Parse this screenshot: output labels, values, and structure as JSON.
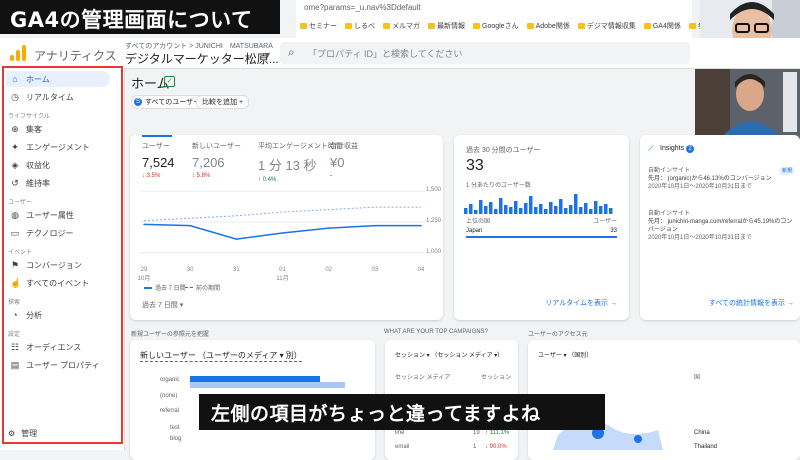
{
  "caption": {
    "title": "GA4の管理画面について",
    "subtitle": "左側の項目がちょっと違ってますよね"
  },
  "browser": {
    "url": "ome?params=_u.nav%3Ddefault",
    "bookmarks": [
      "セミナー",
      "しるべ",
      "メルマガ",
      "最新情報",
      "Googleさん",
      "Adobe関係",
      "デジマ情報収集",
      "GA4関係",
      "参考LPデザイン"
    ]
  },
  "header": {
    "app_name": "アナリティクス",
    "account_path": "すべてのアカウント > JUNICHI　MATSUBARA",
    "property_name": "デジタルマーケッター松原...",
    "search_placeholder": "「プロパティ ID」と検索してください",
    "colors": {
      "logo": "#f9ab00",
      "accent": "#1a73e8"
    }
  },
  "sidebar": {
    "items": [
      {
        "label": "ホーム",
        "icon": "home-icon",
        "glyph": "⌂",
        "active": true
      },
      {
        "label": "リアルタイム",
        "icon": "clock-icon",
        "glyph": "◷"
      }
    ],
    "sections": [
      {
        "title": "ライフサイクル",
        "items": [
          {
            "label": "集客",
            "icon": "acquisition-icon",
            "glyph": "⊕"
          },
          {
            "label": "エンゲージメント",
            "icon": "engagement-icon",
            "glyph": "✦"
          },
          {
            "label": "収益化",
            "icon": "monetization-icon",
            "glyph": "◈"
          },
          {
            "label": "維持率",
            "icon": "retention-icon",
            "glyph": "↺"
          }
        ]
      },
      {
        "title": "ユーザー",
        "items": [
          {
            "label": "ユーザー属性",
            "icon": "globe-icon",
            "glyph": "◍"
          },
          {
            "label": "テクノロジー",
            "icon": "devices-icon",
            "glyph": "▭"
          }
        ]
      },
      {
        "title": "イベント",
        "items": [
          {
            "label": "コンバージョン",
            "icon": "flag-icon",
            "glyph": "⚑"
          },
          {
            "label": "すべてのイベント",
            "icon": "touch-icon",
            "glyph": "☝"
          }
        ]
      },
      {
        "title": "探索",
        "items": [
          {
            "label": "分析",
            "icon": "analysis-icon",
            "glyph": "◔"
          }
        ]
      },
      {
        "title": "設定",
        "items": [
          {
            "label": "オーディエンス",
            "icon": "audience-icon",
            "glyph": "☷"
          },
          {
            "label": "ユーザー プロパティ",
            "icon": "property-icon",
            "glyph": "▤"
          }
        ]
      }
    ],
    "admin_label": "管理"
  },
  "main": {
    "title": "ホーム",
    "chip_all_users": "すべてのユーザー",
    "chip_all_users_avatar": "S",
    "chip_add_compare": "比較を追加",
    "metrics": [
      {
        "label": "ユーザー",
        "value": "7,524",
        "change": "↓ 3.5%",
        "dir": "down"
      },
      {
        "label": "新しいユーザー",
        "value": "7,206",
        "change": "↓ 5.8%",
        "dir": "down"
      },
      {
        "label": "平均エンゲージメント時間",
        "value": "1 分 13 秒",
        "change": "↑ 0.4%",
        "dir": "up"
      },
      {
        "label": "合計収益",
        "value": "¥0",
        "change": "-",
        "dir": "none"
      }
    ],
    "chart_legend": {
      "current": "過去 7 日間",
      "previous": "前の期間"
    },
    "date_range": "過去 7 日間 ▾",
    "x_ticks": [
      "29\n10月",
      "30",
      "31",
      "01\n11月",
      "02",
      "03",
      "04"
    ],
    "y_ticks": [
      "1,500",
      "1,250",
      "1,000"
    ],
    "realtime": {
      "title": "過去 30 分間のユーザー",
      "value": "33",
      "sub": "1 分あたりのユーザー数",
      "col1": "上位の国",
      "col2": "ユーザー",
      "country": "Japan",
      "count": "33",
      "link": "リアルタイムを表示 →"
    },
    "insights": {
      "title": "Insights",
      "badge": "2",
      "items": [
        {
          "head": "自動インサイト",
          "text": "先月： (organic)から46.13%のコンバージョン",
          "date": "2020年10月1日〜2020年10月31日まで",
          "tag": "新規"
        },
        {
          "head": "自動インサイト",
          "text": "先月： junichiri-manga.com/referralから45.19%のコンバージョン",
          "date": "2020年10月1日〜2020年10月31日まで"
        }
      ],
      "link": "すべての統計情報を表示 →"
    },
    "lower": {
      "h1": "新規ユーザーの参照元を把握",
      "h2": "WHAT ARE YOUR TOP CAMPAIGNS?",
      "h3": "ユーザーのアクセス元",
      "card1_selector": "新しいユーザー （ユーザーのメディア ▾ 別）",
      "card1_sources": [
        "organic",
        "(none)",
        "referral",
        "test",
        "blog"
      ],
      "card2_selector": "セッション ▾ （セッション メディア ▾）",
      "card2_col1": "セッション メディア",
      "card2_col2": "セッション",
      "card2_rows": [
        {
          "name": "line",
          "value": "19",
          "chg": "↑ 111.1%"
        },
        {
          "name": "email",
          "value": "1",
          "chg": "↓ 90.0%"
        }
      ],
      "card3_selector": "ユーザー ▾ （国別）",
      "card3_col": "国",
      "card3_rows": [
        "China",
        "Thailand"
      ]
    }
  },
  "chart_data": {
    "type": "line",
    "categories": [
      "29 10月",
      "30",
      "31",
      "01 11月",
      "02",
      "03",
      "04"
    ],
    "series": [
      {
        "name": "過去 7 日間",
        "values": [
          1230,
          1220,
          1110,
          1160,
          1200,
          1220,
          1220
        ]
      },
      {
        "name": "前の期間",
        "values": [
          1260,
          1280,
          1300,
          1330,
          1350,
          1370,
          1370
        ]
      }
    ],
    "ylim": [
      900,
      1550
    ],
    "legend": "bottom-left"
  }
}
